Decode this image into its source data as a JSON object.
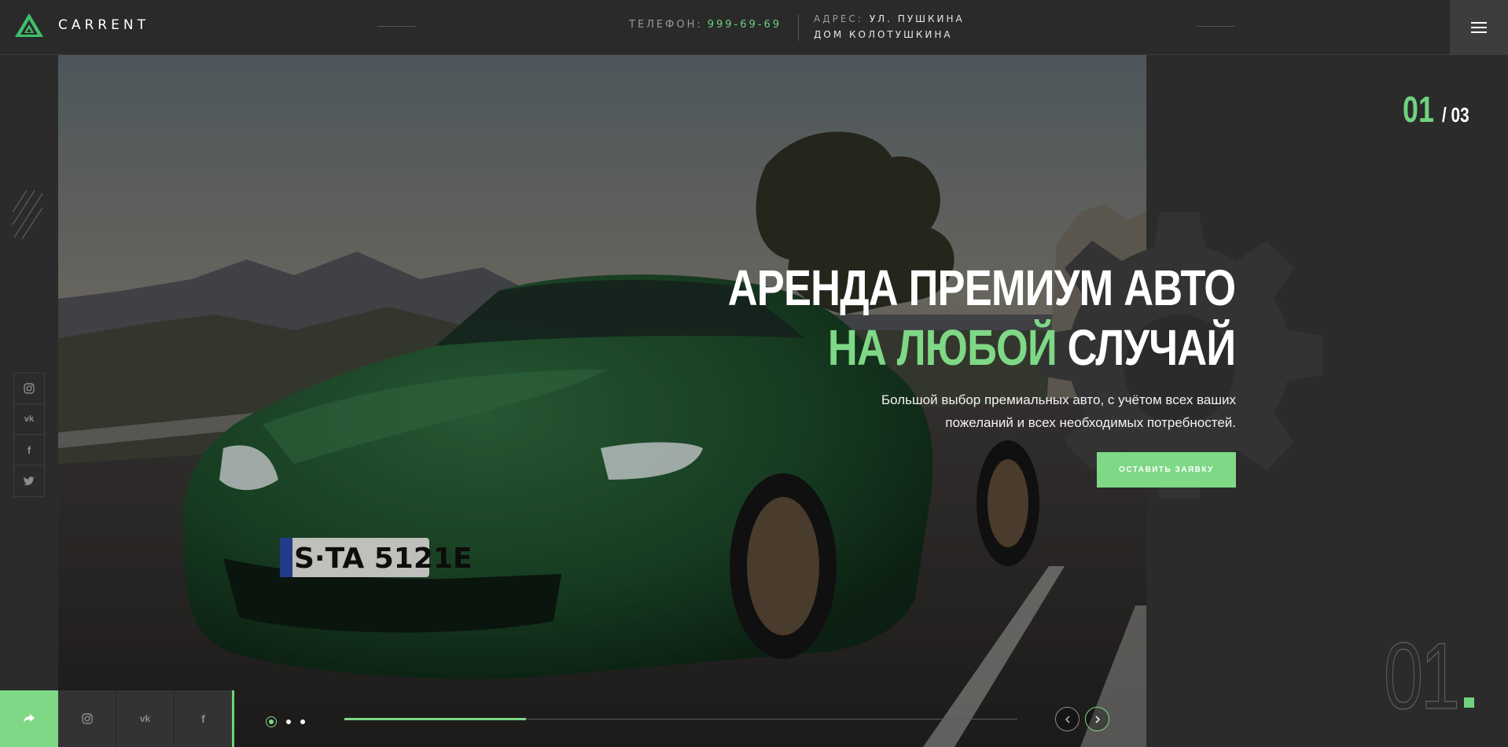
{
  "header": {
    "brand": "CARRENT",
    "phone_label": "ТЕЛЕФОН:",
    "phone_value": "999-69-69",
    "address_label": "АДРЕС:",
    "address_line1": "УЛ. ПУШКИНА",
    "address_line2": "ДОМ КОЛОТУШКИНА",
    "menu_icon": "hamburger-icon"
  },
  "left_social": [
    {
      "name": "instagram",
      "glyph": "◎"
    },
    {
      "name": "vk",
      "glyph": "vk"
    },
    {
      "name": "facebook",
      "glyph": "f"
    },
    {
      "name": "twitter",
      "glyph": "🐦"
    }
  ],
  "hero": {
    "title_line1": "АРЕНДА ПРЕМИУМ АВТО",
    "title_line2_accent": "НА ЛЮБОЙ",
    "title_line2_rest": "СЛУЧАЙ",
    "subtitle": "Большой выбор премиальных авто, с учётом всех ваших пожеланий и всех необходимых потребностей.",
    "cta_label": "ОСТАВИТЬ ЗАЯВКУ"
  },
  "slider": {
    "current": "01",
    "total": "/ 03",
    "big_number": "01",
    "progress_fraction": 0.27,
    "dots": 3,
    "active_dot": 0,
    "prev_icon": "chevron-left-icon",
    "next_icon": "chevron-right-icon"
  },
  "bottom_social": [
    {
      "name": "instagram",
      "glyph": "◎"
    },
    {
      "name": "vk",
      "glyph": "vk"
    },
    {
      "name": "facebook",
      "glyph": "f"
    }
  ],
  "colors": {
    "accent": "#7ed886",
    "background": "#2b2b2b",
    "header": "#2a2a2a"
  }
}
